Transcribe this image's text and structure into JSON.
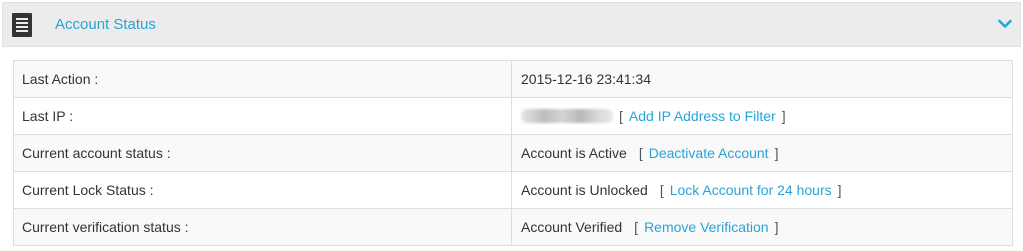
{
  "header": {
    "title": "Account Status",
    "icon": "document-icon",
    "toggle_icon": "chevron-down-icon",
    "accent_color": "#2aa3d6"
  },
  "rows": [
    {
      "label": "Last Action :",
      "value": "2015-12-16 23:41:34",
      "action": ""
    },
    {
      "label": "Last IP :",
      "value": "",
      "action": "Add IP Address to Filter"
    },
    {
      "label": "Current account status :",
      "value": "Account is Active",
      "action": "Deactivate Account"
    },
    {
      "label": "Current Lock Status :",
      "value": "Account is Unlocked",
      "action": "Lock Account for 24 hours"
    },
    {
      "label": "Current verification status :",
      "value": "Account Verified",
      "action": "Remove Verification"
    }
  ],
  "brackets": {
    "open": "[",
    "close": "]"
  }
}
